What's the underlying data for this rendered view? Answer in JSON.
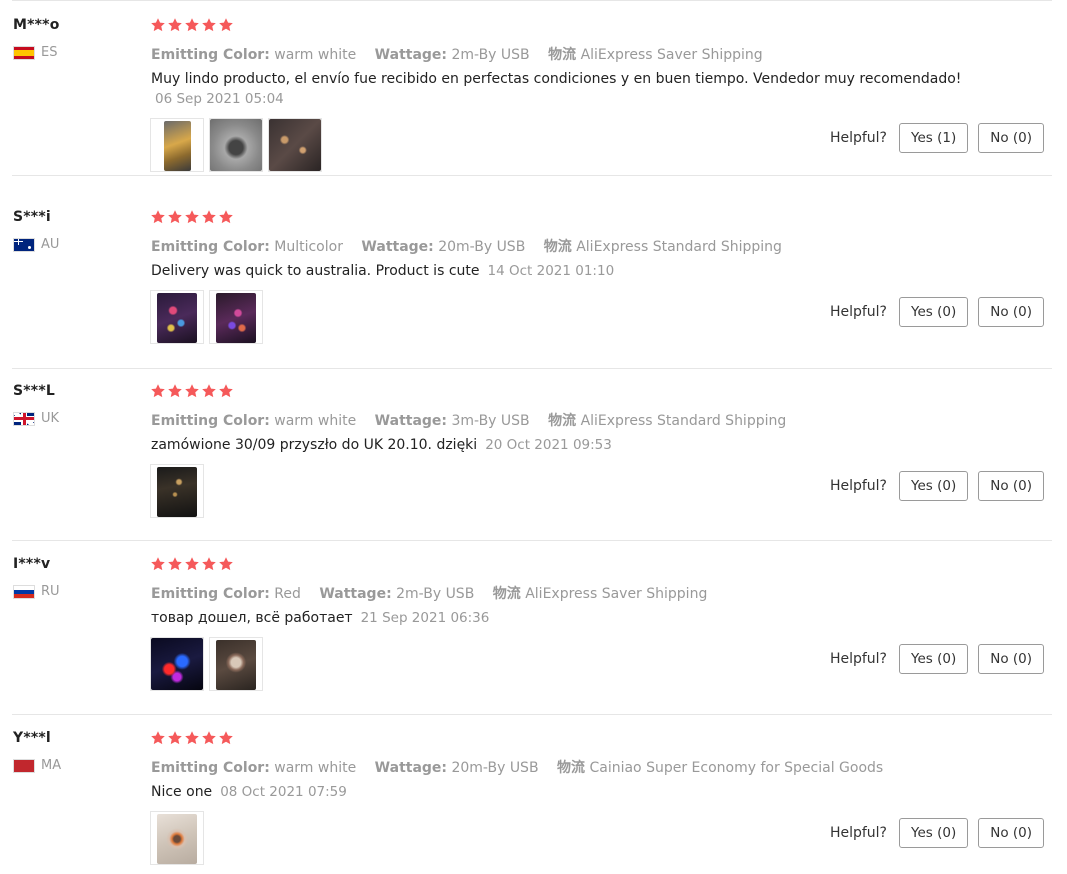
{
  "labels": {
    "emitting_color": "Emitting Color:",
    "wattage": "Wattage:",
    "logistics": "物流",
    "helpful": "Helpful?"
  },
  "colors": {
    "star": "#f5595a",
    "flag_es": "#c60b1e",
    "flag_ma": "#c1272d"
  },
  "reviews": [
    {
      "user": "M***o",
      "country": "ES",
      "flag_icon": "spain-flag-icon",
      "rating": 5,
      "emitting_color": "warm white",
      "wattage": "2m-By USB",
      "shipping": "AliExpress Saver Shipping",
      "feedback": "Muy lindo producto, el envío fue recibido en perfectas condiciones y en buen tiempo. Vendedor muy recomendado!",
      "date": "06 Sep 2021 05:04",
      "photos": [
        "review-photo",
        "review-photo",
        "review-photo"
      ],
      "helpful_yes": "Yes (1)",
      "helpful_no": "No (0)"
    },
    {
      "user": "S***i",
      "country": "AU",
      "flag_icon": "australia-flag-icon",
      "rating": 5,
      "emitting_color": "Multicolor",
      "wattage": "20m-By USB",
      "shipping": "AliExpress Standard Shipping",
      "feedback": "Delivery was quick to australia. Product is cute",
      "date": "14 Oct 2021 01:10",
      "photos": [
        "review-photo",
        "review-photo"
      ],
      "helpful_yes": "Yes (0)",
      "helpful_no": "No (0)"
    },
    {
      "user": "S***L",
      "country": "UK",
      "flag_icon": "uk-flag-icon",
      "rating": 5,
      "emitting_color": "warm white",
      "wattage": "3m-By USB",
      "shipping": "AliExpress Standard Shipping",
      "feedback": "zamówione 30/09 przyszło do UK 20.10. dzięki",
      "date": "20 Oct 2021 09:53",
      "photos": [
        "review-photo"
      ],
      "helpful_yes": "Yes (0)",
      "helpful_no": "No (0)"
    },
    {
      "user": "I***v",
      "country": "RU",
      "flag_icon": "russia-flag-icon",
      "rating": 5,
      "emitting_color": "Red",
      "wattage": "2m-By USB",
      "shipping": "AliExpress Saver Shipping",
      "feedback": "товар дошел, всё работает",
      "date": "21 Sep 2021 06:36",
      "photos": [
        "review-photo",
        "review-photo"
      ],
      "helpful_yes": "Yes (0)",
      "helpful_no": "No (0)"
    },
    {
      "user": "Y***l",
      "country": "MA",
      "flag_icon": "morocco-flag-icon",
      "rating": 5,
      "emitting_color": "warm white",
      "wattage": "20m-By USB",
      "shipping": "Cainiao Super Economy for Special Goods",
      "feedback": "Nice one",
      "date": "08 Oct 2021 07:59",
      "photos": [
        "review-photo"
      ],
      "helpful_yes": "Yes (0)",
      "helpful_no": "No (0)"
    }
  ]
}
